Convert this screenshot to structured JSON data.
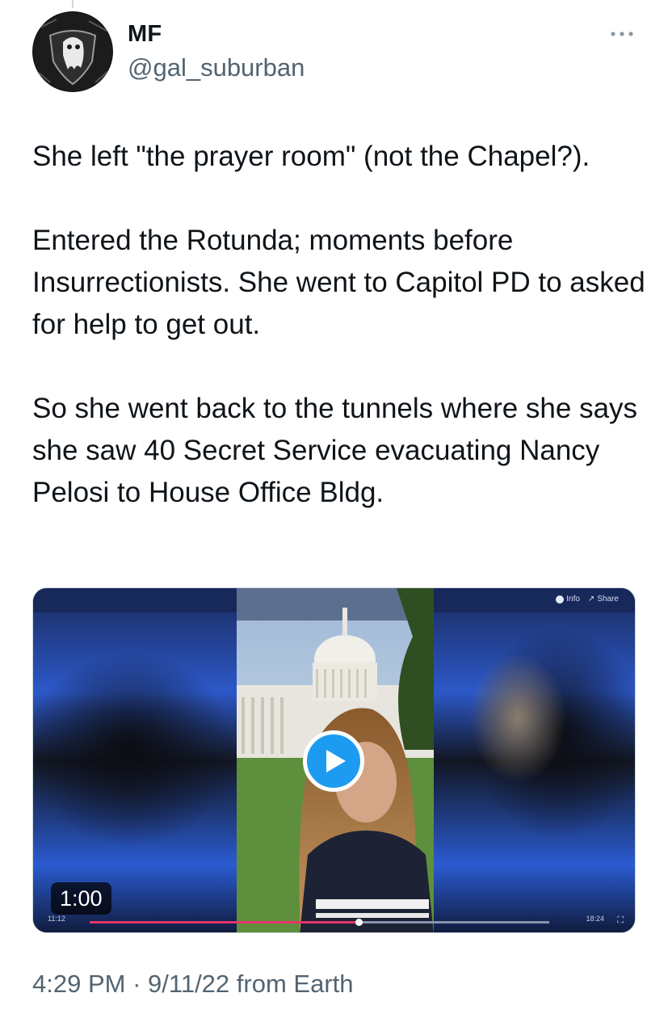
{
  "author": {
    "name": "MF",
    "handle": "@gal_suburban"
  },
  "icons": {
    "more": "more-icon",
    "avatar": "ghost-shield-avatar",
    "play": "play-icon"
  },
  "tweet": {
    "paragraphs": [
      "She left \"the prayer room\" (not the Chapel?).",
      "Entered the Rotunda; moments before Insurrectionists. She went to Capitol PD to asked for help to get out.",
      "So she went back to the tunnels where she says she saw 40 Secret Service evacuating Nancy Pelosi to House Office Bldg."
    ]
  },
  "video": {
    "duration": "1:00",
    "top_links": {
      "info": "Info",
      "share": "Share"
    },
    "elapsed": "11:12",
    "total": "18:24",
    "progress": 0.585,
    "accent": "#1d9bf0",
    "progress_color": "#e5346a"
  },
  "meta": {
    "time": "4:29 PM",
    "separator": "·",
    "date": "9/11/22",
    "source": "from Earth"
  }
}
